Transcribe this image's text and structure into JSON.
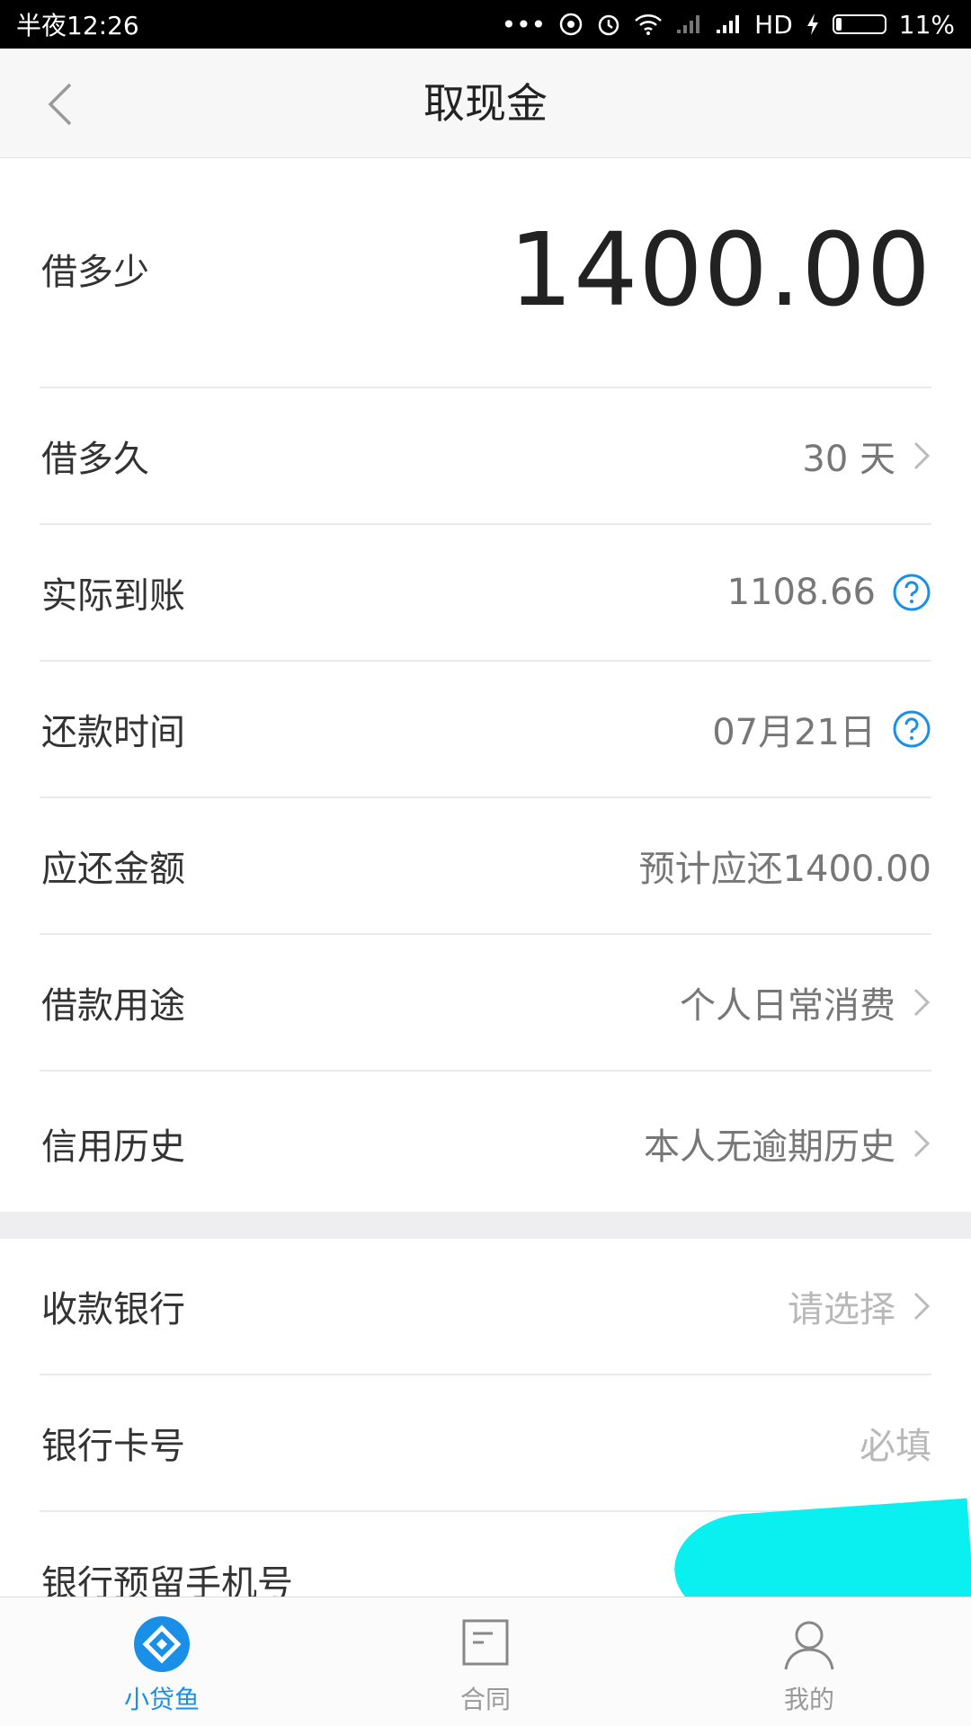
{
  "status_bar": {
    "time": "半夜12:26",
    "network": "HD",
    "battery": "11%",
    "battery_level": 0.11
  },
  "header": {
    "title": "取现金",
    "back_icon": "chevron-left-icon"
  },
  "amount": {
    "label": "借多少",
    "value": "1400.00"
  },
  "rows": [
    {
      "label": "借多久",
      "value": "30 天",
      "accessory": "chevron-right-icon"
    },
    {
      "label": "实际到账",
      "value": "1108.66",
      "accessory": "help-icon"
    },
    {
      "label": "还款时间",
      "value": "07月21日",
      "accessory": "help-icon"
    },
    {
      "label": "应还金额",
      "value": "预计应还1400.00",
      "accessory": "none"
    },
    {
      "label": "借款用途",
      "value": "个人日常消费",
      "accessory": "chevron-right-icon"
    },
    {
      "label": "信用历史",
      "value": "本人无逾期历史",
      "accessory": "chevron-right-icon"
    }
  ],
  "bank_rows": [
    {
      "label": "收款银行",
      "value": "请选择",
      "accessory": "chevron-right-icon",
      "placeholder": true
    },
    {
      "label": "银行卡号",
      "value": "必填",
      "accessory": "none",
      "placeholder": true
    },
    {
      "label": "银行预留手机号",
      "value": "",
      "accessory": "none"
    }
  ],
  "tabs": [
    {
      "label": "小贷鱼",
      "icon": "diamond-logo-icon",
      "active": true
    },
    {
      "label": "合同",
      "icon": "contract-icon",
      "active": false
    },
    {
      "label": "我的",
      "icon": "user-icon",
      "active": false
    }
  ],
  "colors": {
    "accent": "#1a8fe8",
    "help_icon": "#1a8fe8",
    "redaction": "#0af0f0"
  }
}
